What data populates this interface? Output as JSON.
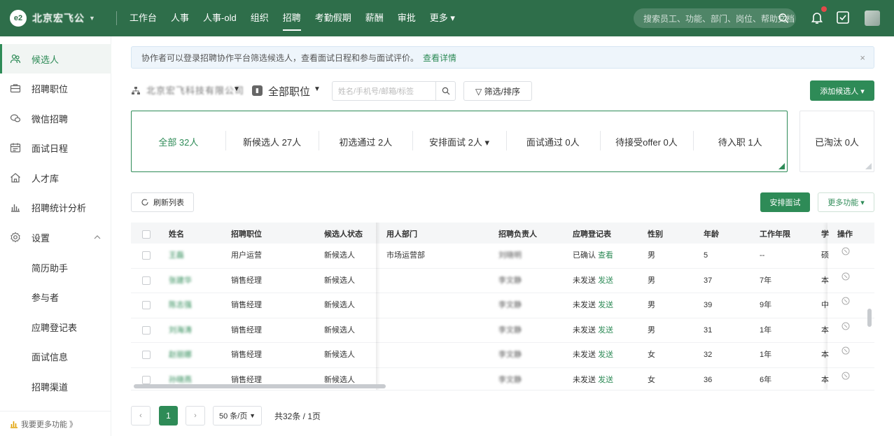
{
  "app": {
    "logo_mark": "e2",
    "name": "北京宏飞公"
  },
  "nav": [
    {
      "label": "工作台"
    },
    {
      "label": "人事"
    },
    {
      "label": "人事-old"
    },
    {
      "label": "组织"
    },
    {
      "label": "招聘",
      "active": true
    },
    {
      "label": "考勤假期"
    },
    {
      "label": "薪酬"
    },
    {
      "label": "审批"
    },
    {
      "label": "更多 ▾"
    }
  ],
  "search": {
    "placeholder": "搜索员工、功能、部门、岗位、帮助文档"
  },
  "sidebar": {
    "items": [
      {
        "label": "候选人",
        "icon": "people-icon",
        "active": true
      },
      {
        "label": "招聘职位",
        "icon": "briefcase-icon"
      },
      {
        "label": "微信招聘",
        "icon": "wechat-icon"
      },
      {
        "label": "面试日程",
        "icon": "calendar-icon"
      },
      {
        "label": "人才库",
        "icon": "home-icon"
      },
      {
        "label": "招聘统计分析",
        "icon": "bar-chart-icon"
      },
      {
        "label": "设置",
        "icon": "gear-icon"
      }
    ],
    "subitems": [
      {
        "label": "简历助手"
      },
      {
        "label": "参与者"
      },
      {
        "label": "应聘登记表"
      },
      {
        "label": "面试信息"
      },
      {
        "label": "招聘渠道"
      }
    ],
    "footer": "我要更多功能 》"
  },
  "notice": {
    "text": "协作者可以登录招聘协作平台筛选候选人，查看面试日程和参与面试评价。",
    "link": "查看详情",
    "close": "×"
  },
  "toolbar": {
    "org_name": "北京宏飞科技有限公司",
    "position": "全部职位",
    "query_placeholder": "姓名/手机号/邮箱/标签",
    "filter_label": "▽ 筛选/排序",
    "add_label": "添加候选人 ▾"
  },
  "stages": [
    {
      "label": "全部 32人",
      "active": true
    },
    {
      "label": "新候选人 27人"
    },
    {
      "label": "初选通过 2人"
    },
    {
      "label": "安排面试 2人 ▾"
    },
    {
      "label": "面试通过 0人"
    },
    {
      "label": "待接受offer 0人"
    },
    {
      "label": "待入职 1人"
    }
  ],
  "eliminated": "已淘汰 0人",
  "actions": {
    "refresh": "刷新列表",
    "schedule": "安排面试",
    "more": "更多功能 ▾"
  },
  "table": {
    "headers": [
      "姓名",
      "招聘职位",
      "候选人状态",
      "用人部门",
      "招聘负责人",
      "应聘登记表",
      "性别",
      "年龄",
      "工作年限",
      "学",
      "操作"
    ],
    "rows": [
      {
        "name": "王磊",
        "position": "用户运营",
        "status": "新候选人",
        "dept": "市场运营部",
        "owner": "刘晓明",
        "form_state": "已确认",
        "form_link": "查看",
        "gender": "男",
        "age": "5",
        "years": "--",
        "edu": "硕"
      },
      {
        "name": "张建华",
        "position": "销售经理",
        "status": "新候选人",
        "dept": "",
        "owner": "李文静",
        "form_state": "未发送",
        "form_link": "发送",
        "gender": "男",
        "age": "37",
        "years": "7年",
        "edu": "本"
      },
      {
        "name": "陈志强",
        "position": "销售经理",
        "status": "新候选人",
        "dept": "",
        "owner": "李文静",
        "form_state": "未发送",
        "form_link": "发送",
        "gender": "男",
        "age": "39",
        "years": "9年",
        "edu": "中"
      },
      {
        "name": "刘海涛",
        "position": "销售经理",
        "status": "新候选人",
        "dept": "",
        "owner": "李文静",
        "form_state": "未发送",
        "form_link": "发送",
        "gender": "男",
        "age": "31",
        "years": "1年",
        "edu": "本"
      },
      {
        "name": "赵丽娜",
        "position": "销售经理",
        "status": "新候选人",
        "dept": "",
        "owner": "李文静",
        "form_state": "未发送",
        "form_link": "发送",
        "gender": "女",
        "age": "32",
        "years": "1年",
        "edu": "本"
      },
      {
        "name": "孙晓燕",
        "position": "销售经理",
        "status": "新候选人",
        "dept": "",
        "owner": "李文静",
        "form_state": "未发送",
        "form_link": "发送",
        "gender": "女",
        "age": "36",
        "years": "6年",
        "edu": "本"
      }
    ]
  },
  "pager": {
    "prev": "‹",
    "current": "1",
    "next": "›",
    "page_size": "50 条/页",
    "total": "共32条 / 1页"
  },
  "colors": {
    "brand": "#2e6e4a",
    "accent": "#2e8b57"
  }
}
